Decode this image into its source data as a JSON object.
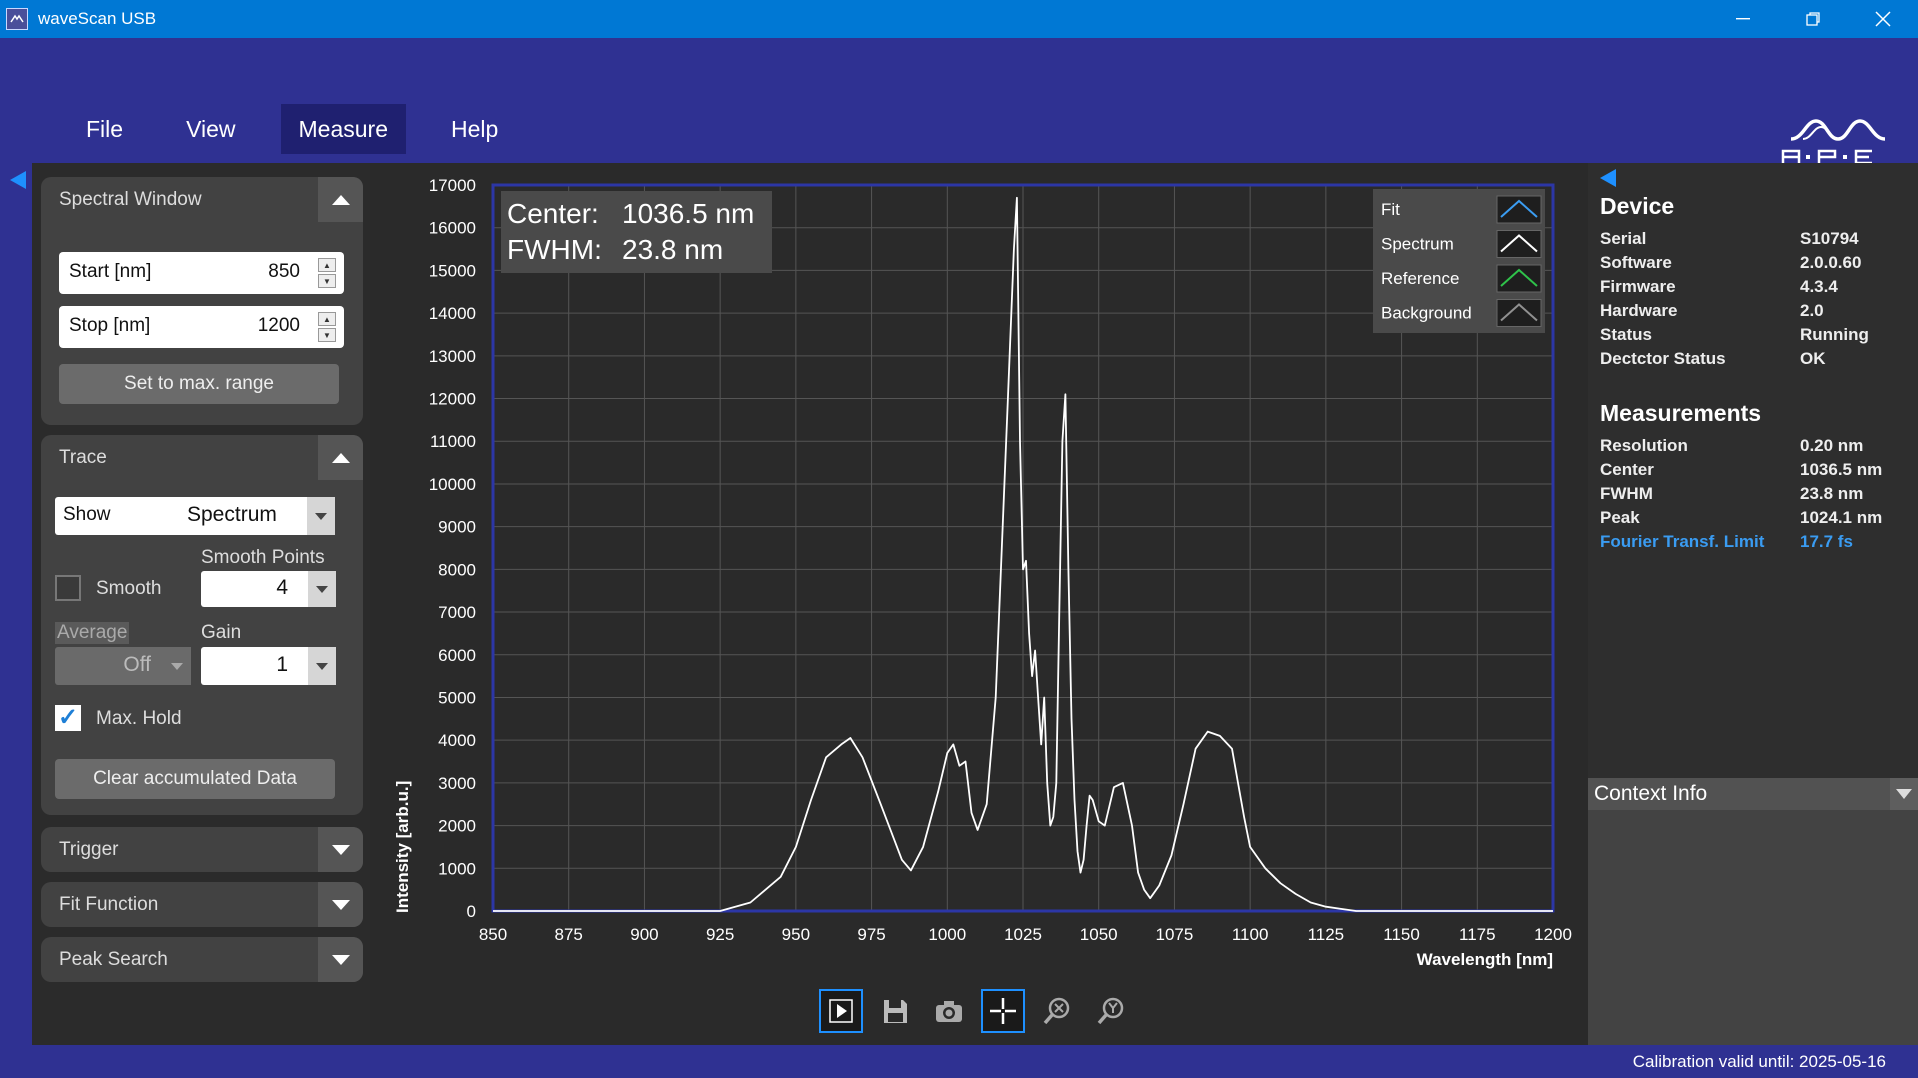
{
  "window": {
    "title": "waveScan USB",
    "controls": [
      "minimize-icon",
      "restore-icon",
      "close-icon"
    ]
  },
  "menu": {
    "items": [
      "File",
      "View",
      "Measure",
      "Help"
    ],
    "active": "Measure"
  },
  "left": {
    "spectral_window": {
      "title": "Spectral Window",
      "start_label": "Start [nm]",
      "start_value": "850",
      "stop_label": "Stop [nm]",
      "stop_value": "1200",
      "max_range_button": "Set to max. range"
    },
    "trace": {
      "title": "Trace",
      "show_label": "Show",
      "show_value": "Spectrum",
      "smooth_label": "Smooth",
      "smooth_checked": false,
      "smooth_points_label": "Smooth Points",
      "smooth_points_value": "4",
      "average_label": "Average",
      "average_value": "Off",
      "gain_label": "Gain",
      "gain_value": "1",
      "maxhold_label": "Max. Hold",
      "maxhold_checked": true,
      "clear_button": "Clear accumulated Data"
    },
    "collapsed": [
      "Trigger",
      "Fit Function",
      "Peak Search"
    ]
  },
  "chart_data": {
    "type": "line",
    "xlabel": "Wavelength [nm]",
    "ylabel": "Intensity [arb.u.]",
    "xlim": [
      850,
      1200
    ],
    "ylim": [
      0,
      17000
    ],
    "xticks": [
      "850",
      "875",
      "900",
      "925",
      "950",
      "975",
      "1000",
      "1025",
      "1050",
      "1075",
      "1100",
      "1125",
      "1150",
      "1175",
      "1200"
    ],
    "yticks": [
      "0",
      "1000",
      "2000",
      "3000",
      "4000",
      "5000",
      "6000",
      "7000",
      "8000",
      "9000",
      "10000",
      "11000",
      "12000",
      "13000",
      "14000",
      "15000",
      "16000",
      "17000"
    ],
    "grid": true,
    "legend": {
      "placement": "top-right",
      "entries": [
        {
          "name": "Fit",
          "color": "#3b9df2"
        },
        {
          "name": "Spectrum",
          "color": "#ffffff"
        },
        {
          "name": "Reference",
          "color": "#2fc24a"
        },
        {
          "name": "Background",
          "color": "#909090"
        }
      ]
    },
    "annotation": {
      "center_label": "Center:",
      "center_value": "1036.5 nm",
      "fwhm_label": "FWHM:",
      "fwhm_value": "23.8 nm"
    },
    "series": [
      {
        "name": "Spectrum",
        "color": "#ffffff",
        "x": [
          850,
          925,
          935,
          945,
          950,
          955,
          960,
          965,
          968,
          972,
          978,
          985,
          988,
          992,
          997,
          1000,
          1002,
          1004,
          1006,
          1008,
          1010,
          1013,
          1016,
          1018,
          1020,
          1022,
          1023,
          1024,
          1025,
          1026,
          1027,
          1028,
          1029,
          1030,
          1031,
          1032,
          1033,
          1034,
          1035,
          1036,
          1037,
          1038,
          1039,
          1040,
          1041,
          1042,
          1043,
          1044,
          1045,
          1046,
          1047,
          1048,
          1050,
          1052,
          1055,
          1058,
          1061,
          1063,
          1065,
          1067,
          1070,
          1074,
          1078,
          1082,
          1086,
          1090,
          1094,
          1096,
          1098,
          1100,
          1102,
          1105,
          1110,
          1115,
          1120,
          1125,
          1130,
          1135,
          1140,
          1145,
          1150,
          1160,
          1200
        ],
        "y": [
          0,
          0,
          200,
          800,
          1500,
          2600,
          3600,
          3900,
          4050,
          3600,
          2500,
          1200,
          950,
          1500,
          2800,
          3700,
          3900,
          3400,
          3500,
          2300,
          1900,
          2500,
          5000,
          8500,
          12000,
          15500,
          16700,
          11000,
          8000,
          8200,
          6500,
          5500,
          6100,
          5000,
          3900,
          5000,
          3000,
          2000,
          2200,
          3000,
          7000,
          11000,
          12100,
          8000,
          4500,
          2600,
          1400,
          900,
          1200,
          2000,
          2700,
          2600,
          2100,
          2000,
          2900,
          3000,
          2000,
          900,
          500,
          300,
          600,
          1300,
          2500,
          3800,
          4200,
          4100,
          3800,
          3000,
          2200,
          1500,
          1300,
          1000,
          650,
          400,
          200,
          100,
          50,
          0,
          0,
          0,
          0,
          0,
          0
        ]
      }
    ]
  },
  "toolbar": {
    "buttons": [
      "play-icon",
      "save-icon",
      "camera-icon",
      "crosshair-icon",
      "zoom-x-icon",
      "zoom-y-icon"
    ],
    "selected": [
      "play-icon",
      "crosshair-icon"
    ]
  },
  "right": {
    "device_title": "Device",
    "device": [
      {
        "k": "Serial",
        "v": "S10794"
      },
      {
        "k": "Software",
        "v": "2.0.0.60"
      },
      {
        "k": "Firmware",
        "v": "4.3.4"
      },
      {
        "k": "Hardware",
        "v": "2.0"
      },
      {
        "k": "Status",
        "v": "Running"
      },
      {
        "k": "Dectctor Status",
        "v": "OK"
      }
    ],
    "measurements_title": "Measurements",
    "measurements": [
      {
        "k": "Resolution",
        "v": "0.20 nm"
      },
      {
        "k": "Center",
        "v": "1036.5 nm"
      },
      {
        "k": "FWHM",
        "v": "23.8 nm"
      },
      {
        "k": "Peak",
        "v": "1024.1 nm"
      },
      {
        "k": "Fourier Transf. Limit",
        "v": "17.7 fs"
      }
    ],
    "context_title": "Context Info"
  },
  "status": {
    "text": "Calibration valid until: 2025-05-16"
  },
  "colors": {
    "title_bar": "#0078d4",
    "accent": "#2f3192",
    "highlight": "#3a9cf2"
  }
}
